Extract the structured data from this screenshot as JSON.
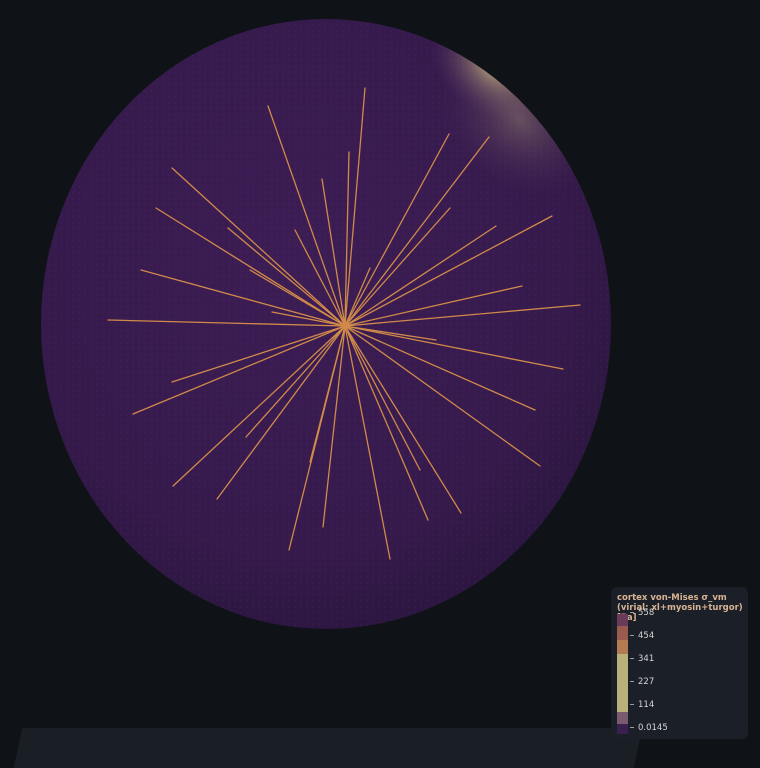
{
  "colorbar": {
    "title": "cortex von-Mises σ_vm (virial: xl+myosin+turgor) [Pa]",
    "ticks": [
      {
        "label": "558",
        "value": 558
      },
      {
        "label": "454",
        "value": 454
      },
      {
        "label": "341",
        "value": 341
      },
      {
        "label": "227",
        "value": 227
      },
      {
        "label": "114",
        "value": 114
      },
      {
        "label": "0.0145",
        "value": 0.0145
      }
    ],
    "range": [
      0.0145,
      558
    ],
    "colors": [
      "#3b1f4e",
      "#7a4a5e",
      "#b47a52",
      "#c9a06a",
      "#b9b07a",
      "#4a2a5a"
    ]
  },
  "scene": {
    "background": "#0f1318",
    "sphere_color": "#3a1d50",
    "fiber_color": "#d08a4a",
    "highlight_color": "#d8cc88"
  }
}
